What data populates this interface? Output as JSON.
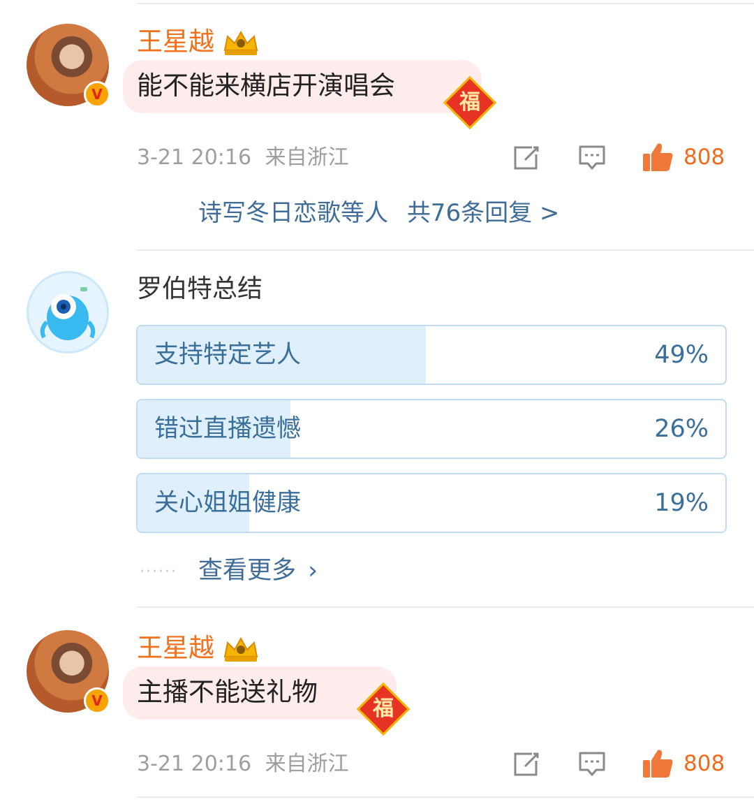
{
  "comments": [
    {
      "username": "王星越",
      "text": "能不能来横店开演唱会",
      "timestamp": "3-21 20:16",
      "location": "来自浙江",
      "likes": "808",
      "replies_users": "诗写冬日恋歌等人",
      "replies_count": "共76条回复 >",
      "fu_badge": "福"
    },
    {
      "username": "王星越",
      "text": "主播不能送礼物",
      "timestamp": "3-21 20:16",
      "location": "来自浙江",
      "likes": "808",
      "fu_badge": "福"
    }
  ],
  "summary": {
    "title": "罗伯特总结",
    "options": [
      {
        "label": "支持特定艺人",
        "percent_text": "49%",
        "fraction": 0.49
      },
      {
        "label": "错过直播遗憾",
        "percent_text": "26%",
        "fraction": 0.26
      },
      {
        "label": "关心姐姐健康",
        "percent_text": "19%",
        "fraction": 0.19
      }
    ],
    "more_label": "查看更多",
    "more_chevron": "›",
    "dots": "······"
  },
  "colors": {
    "username": "#f3711d",
    "likes": "#f26b1d",
    "link": "#3f6c98",
    "poll_fill": "#dff0fc"
  },
  "icons": [
    "share-icon",
    "comment-icon",
    "thumbs-up-icon",
    "crown-badge-icon",
    "verified-badge-icon"
  ]
}
